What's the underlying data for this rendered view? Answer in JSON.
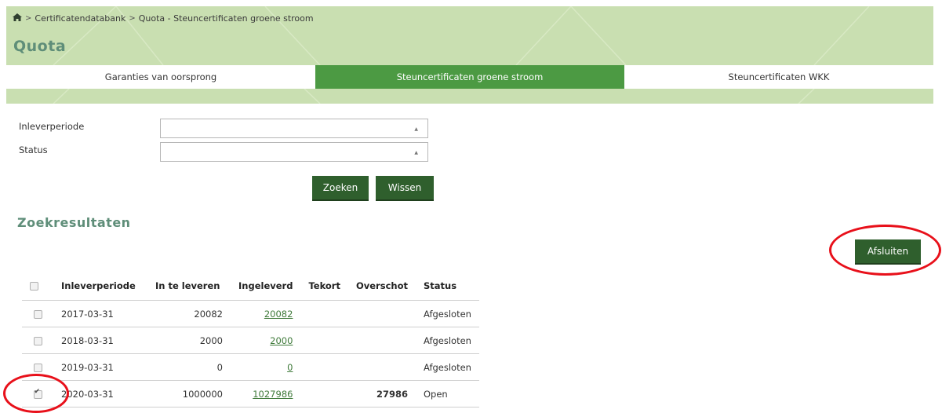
{
  "breadcrumb": {
    "home_icon": "home-icon",
    "items": [
      "Certificatendatabank",
      "Quota - Steuncertificaten groene stroom"
    ],
    "separator": ">"
  },
  "page_title": "Quota",
  "tabs": [
    {
      "label": "Garanties van oorsprong",
      "active": false
    },
    {
      "label": "Steuncertificaten groene stroom",
      "active": true
    },
    {
      "label": "Steuncertificaten WKK",
      "active": false
    }
  ],
  "filters": {
    "inleverperiode_label": "Inleverperiode",
    "inleverperiode_value": "",
    "status_label": "Status",
    "status_value": ""
  },
  "buttons": {
    "search": "Zoeken",
    "clear": "Wissen",
    "close": "Afsluiten"
  },
  "results": {
    "title": "Zoekresultaten",
    "columns": [
      "Inleverperiode",
      "In te leveren",
      "Ingeleverd",
      "Tekort",
      "Overschot",
      "Status"
    ],
    "rows": [
      {
        "checked": false,
        "period": "2017-03-31",
        "due": "20082",
        "delivered": "20082",
        "shortage": "",
        "surplus": "",
        "status": "Afgesloten"
      },
      {
        "checked": false,
        "period": "2018-03-31",
        "due": "2000",
        "delivered": "2000",
        "shortage": "",
        "surplus": "",
        "status": "Afgesloten"
      },
      {
        "checked": false,
        "period": "2019-03-31",
        "due": "0",
        "delivered": "0",
        "shortage": "",
        "surplus": "",
        "status": "Afgesloten"
      },
      {
        "checked": true,
        "period": "2020-03-31",
        "due": "1000000",
        "delivered": "1027986",
        "shortage": "",
        "surplus": "27986",
        "status": "Open"
      }
    ]
  },
  "colors": {
    "header_bg": "#c9dfb1",
    "active_tab": "#4c9a43",
    "button_bg": "#2f5f2d",
    "title_color": "#5f8e79",
    "annotation_red": "#e8101a"
  }
}
